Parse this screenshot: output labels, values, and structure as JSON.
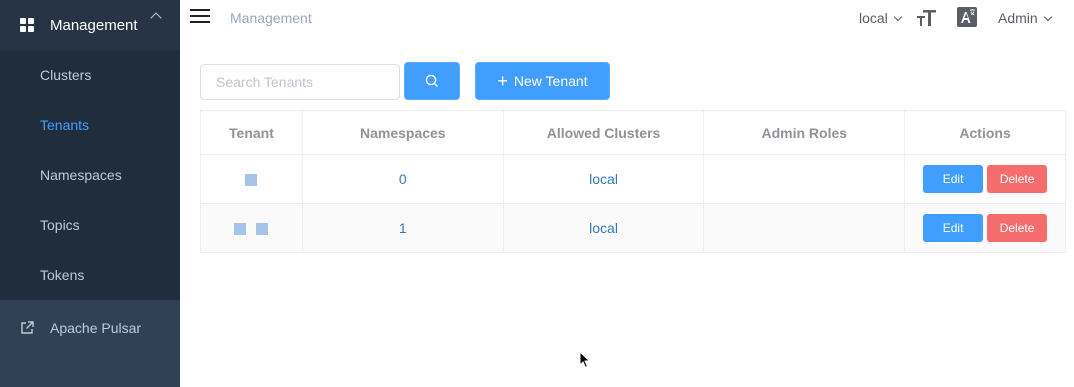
{
  "sidebar": {
    "parent_label": "Management",
    "items": [
      {
        "label": "Clusters",
        "active": false
      },
      {
        "label": "Tenants",
        "active": true
      },
      {
        "label": "Namespaces",
        "active": false
      },
      {
        "label": "Topics",
        "active": false
      },
      {
        "label": "Tokens",
        "active": false
      }
    ],
    "external_label": "Apache Pulsar"
  },
  "navbar": {
    "breadcrumb": "Management",
    "environment": "local",
    "user": "Admin"
  },
  "toolbar": {
    "search_placeholder": "Search Tenants",
    "new_label": "New Tenant"
  },
  "table": {
    "headers": [
      "Tenant",
      "Namespaces",
      "Allowed Clusters",
      "Admin Roles",
      "Actions"
    ],
    "rows": [
      {
        "namespaces": "0",
        "allowed_clusters": "local",
        "admin_roles": ""
      },
      {
        "namespaces": "1",
        "allowed_clusters": "local",
        "admin_roles": ""
      }
    ],
    "edit_label": "Edit",
    "delete_label": "Delete"
  },
  "colors": {
    "sidebar_bg": "#304156",
    "active": "#409eff",
    "primary": "#409eff",
    "danger": "#f56c6c"
  }
}
